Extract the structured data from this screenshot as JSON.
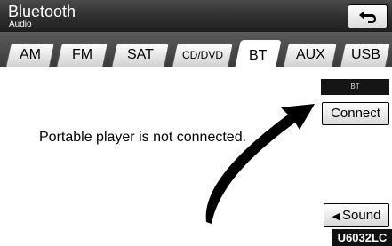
{
  "header": {
    "title": "Bluetooth",
    "subtitle": "Audio",
    "back_icon": "return-arrow-icon"
  },
  "tabs": [
    {
      "label": "AM"
    },
    {
      "label": "FM"
    },
    {
      "label": "SAT"
    },
    {
      "label": "CD/DVD"
    },
    {
      "label": "BT",
      "active": true
    },
    {
      "label": "AUX"
    },
    {
      "label": "USB"
    }
  ],
  "main": {
    "mode_badge": "BT",
    "connect_label": "Connect",
    "message": "Portable player is not connected."
  },
  "footer": {
    "sound_icon": "speaker-icon",
    "sound_label": "Sound",
    "figure_code": "U6032LC"
  },
  "colors": {
    "header_bg": "#2e2e2e",
    "arrow": "#000000"
  }
}
